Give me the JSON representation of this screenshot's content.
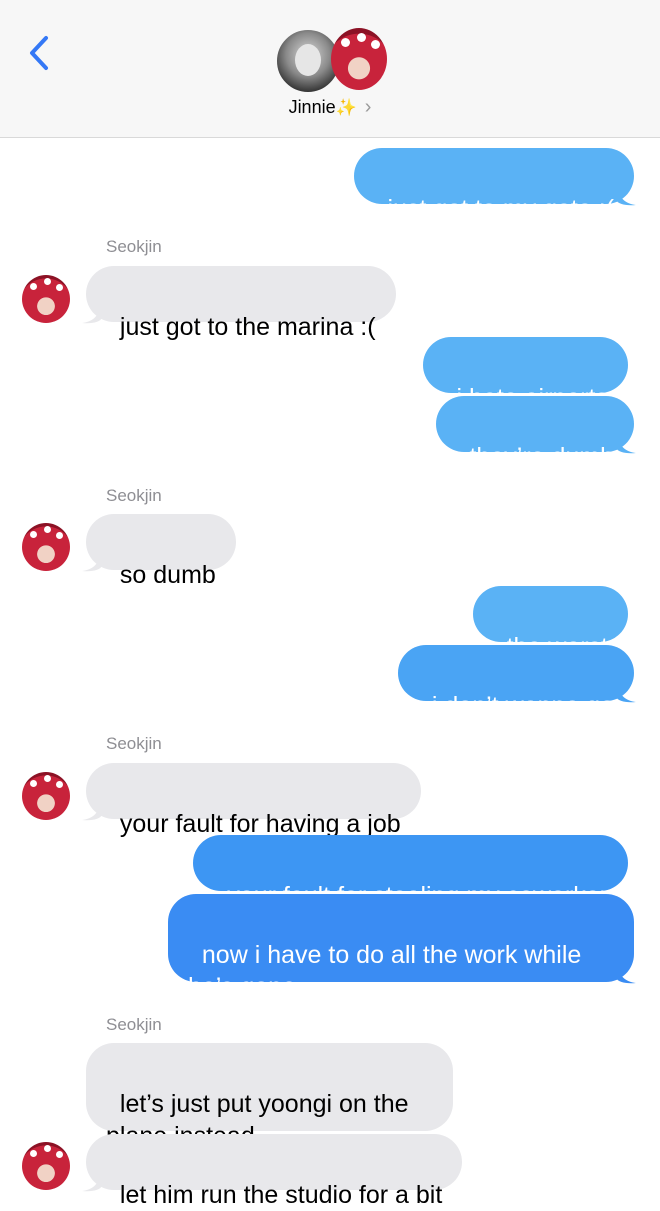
{
  "header": {
    "contact_name": "Jinnie",
    "sparkle": "✨",
    "chevron": "›",
    "back_icon": "chevron-left-icon"
  },
  "colors": {
    "outgoing": "#3d96f3",
    "outgoing_light": "#5ab2f5",
    "incoming": "#e8e8eb",
    "back_accent": "#3478f6"
  },
  "sender_name": "Seokjin",
  "messages": [
    {
      "from": "me",
      "text": "just got to my gate :("
    },
    {
      "from": "them",
      "text": "just got to the marina :("
    },
    {
      "from": "me",
      "text": "i hate airports"
    },
    {
      "from": "me",
      "text": "they’re dumb"
    },
    {
      "from": "them",
      "text": "so dumb"
    },
    {
      "from": "me",
      "text": "the worst"
    },
    {
      "from": "me",
      "text": "i don’t wanna go"
    },
    {
      "from": "them",
      "text": "your fault for having a job"
    },
    {
      "from": "me",
      "text": "your fault for stealing my coworker"
    },
    {
      "from": "me",
      "text": "now i have to do all the work while he’s gone"
    },
    {
      "from": "them",
      "text": "let’s just put yoongi on the plane instead"
    },
    {
      "from": "them",
      "text": "let him run the studio for a bit"
    }
  ]
}
